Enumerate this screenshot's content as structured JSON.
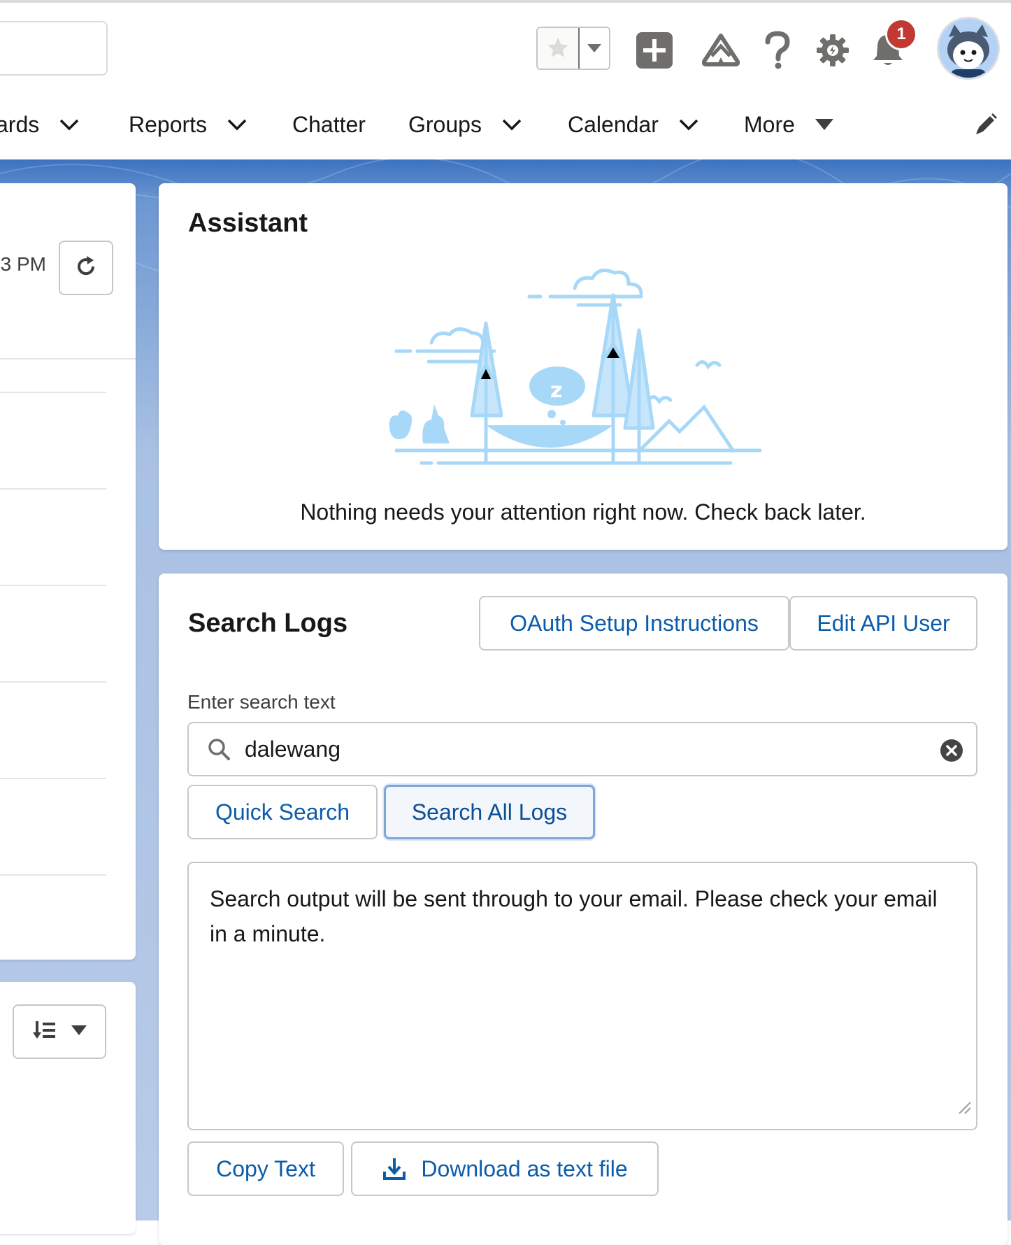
{
  "header": {
    "notification_count": "1"
  },
  "nav": {
    "items": [
      {
        "label": "ards"
      },
      {
        "label": "Reports"
      },
      {
        "label": "Chatter"
      },
      {
        "label": "Groups"
      },
      {
        "label": "Calendar"
      },
      {
        "label": "More"
      }
    ]
  },
  "left_panel": {
    "time_text": "3 PM"
  },
  "assistant": {
    "title": "Assistant",
    "message": "Nothing needs your attention right now. Check back later."
  },
  "search_logs": {
    "title": "Search Logs",
    "oauth_label": "OAuth Setup Instructions",
    "edit_api_label": "Edit API User",
    "field_label": "Enter search text",
    "search_value": "dalewang",
    "quick_search_label": "Quick Search",
    "search_all_label": "Search All Logs",
    "output_text": "Search output will be sent through to your email. Please check your email in a minute.",
    "copy_label": "Copy Text",
    "download_label": "Download as text file"
  },
  "colors": {
    "brand_blue": "#1b63c2",
    "link_blue": "#0b5cab",
    "badge_red": "#c23934",
    "illustration_blue": "#a8d8f8"
  }
}
